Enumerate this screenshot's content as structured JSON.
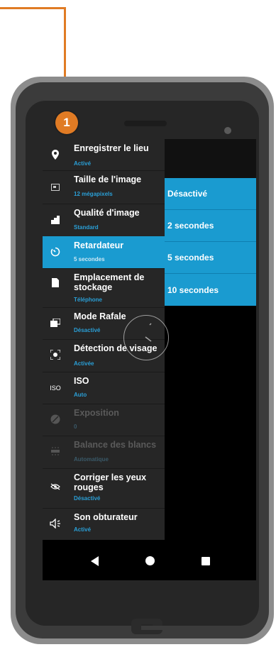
{
  "callout": {
    "number": "1",
    "color": "#e07b24"
  },
  "menu": {
    "items": [
      {
        "icon": "location-pin-icon",
        "title": "Enregistrer le lieu",
        "subtitle": "Activé"
      },
      {
        "icon": "image-size-icon",
        "title": "Taille de l'image",
        "subtitle": "12 mégapixels"
      },
      {
        "icon": "quality-bars-icon",
        "title": "Qualité d'image",
        "subtitle": "Standard"
      },
      {
        "icon": "timer-icon",
        "title": "Retardateur",
        "subtitle": "5 secondes",
        "selected": true
      },
      {
        "icon": "storage-card-icon",
        "title": "Emplacement de stockage",
        "subtitle": "Téléphone"
      },
      {
        "icon": "burst-mode-icon",
        "title": "Mode Rafale",
        "subtitle": "Désactivé"
      },
      {
        "icon": "face-detection-icon",
        "title": "Détection de visage",
        "subtitle": "Activée"
      },
      {
        "icon": "iso-icon",
        "title": "ISO",
        "subtitle": "Auto"
      },
      {
        "icon": "exposure-icon",
        "title": "Exposition",
        "subtitle": "0",
        "disabled": true
      },
      {
        "icon": "white-balance-icon",
        "title": "Balance des blancs",
        "subtitle": "Automatique",
        "disabled": true
      },
      {
        "icon": "red-eye-icon",
        "title": "Corriger les yeux rouges",
        "subtitle": "Désactivé"
      },
      {
        "icon": "shutter-sound-icon",
        "title": "Son obturateur",
        "subtitle": "Activé"
      }
    ]
  },
  "submenu": {
    "options": [
      "Désactivé",
      "2 secondes",
      "5 secondes",
      "10 secondes"
    ]
  },
  "icons": {
    "iso_label": "ISO"
  },
  "colors": {
    "accent": "#1a9bd0",
    "menu_bg": "#262626",
    "subtitle": "#2a9fd6"
  }
}
